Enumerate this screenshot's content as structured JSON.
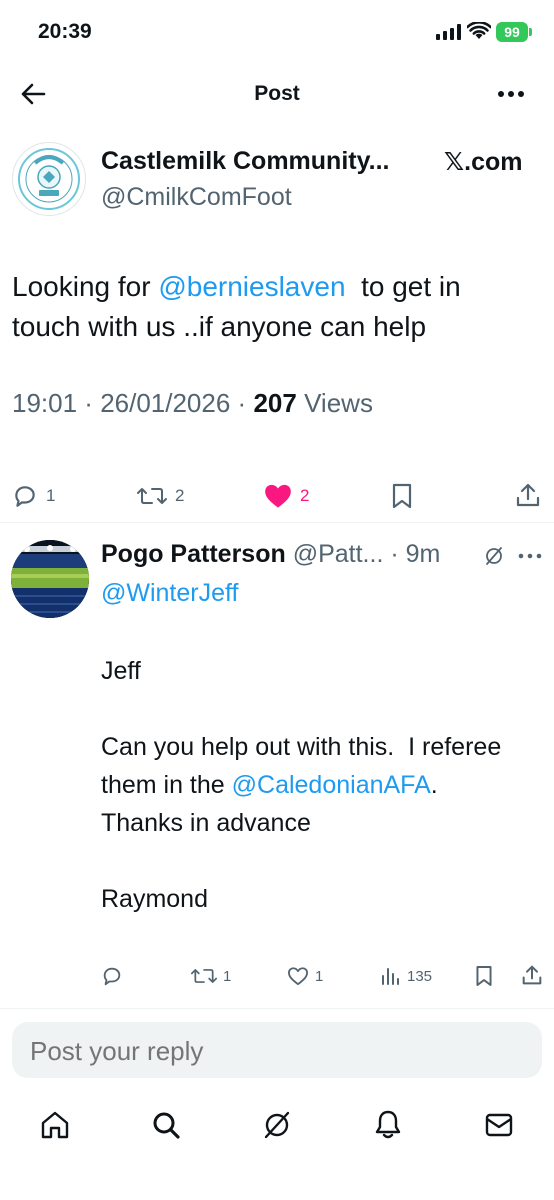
{
  "status_bar": {
    "time": "20:39",
    "battery": "99"
  },
  "header": {
    "title": "Post"
  },
  "post": {
    "author_name": "Castlemilk Community...",
    "author_handle": "@CmilkComFoot",
    "source": "𝕏.com",
    "text_prefix": "Looking for ",
    "mention": "@bernieslaven",
    "text_suffix": "  to get in touch with us ..if anyone can help",
    "time": "19:01",
    "date": "26/01/2026",
    "views_count": "207",
    "views_label": "Views",
    "replies": "1",
    "reposts": "2",
    "likes": "2"
  },
  "reply": {
    "author_name": "Pogo Patterson",
    "author_handle": "@Patt...",
    "age": "9m",
    "replying_to": "@WinterJeff",
    "line1": "Jeff",
    "line2_prefix": "Can you help out with this.  I referee them in the ",
    "line2_mention": "@CaledonianAFA",
    "line2_suffix": ". Thanks in advance",
    "line3": "Raymond",
    "replies": "",
    "reposts": "1",
    "likes": "1",
    "views": "135"
  },
  "composer": {
    "placeholder": "Post your reply"
  },
  "colors": {
    "accent": "#1d9bf0",
    "like": "#f91880",
    "battery": "#34c759",
    "text": "#0f1419",
    "secondary": "#536471"
  }
}
